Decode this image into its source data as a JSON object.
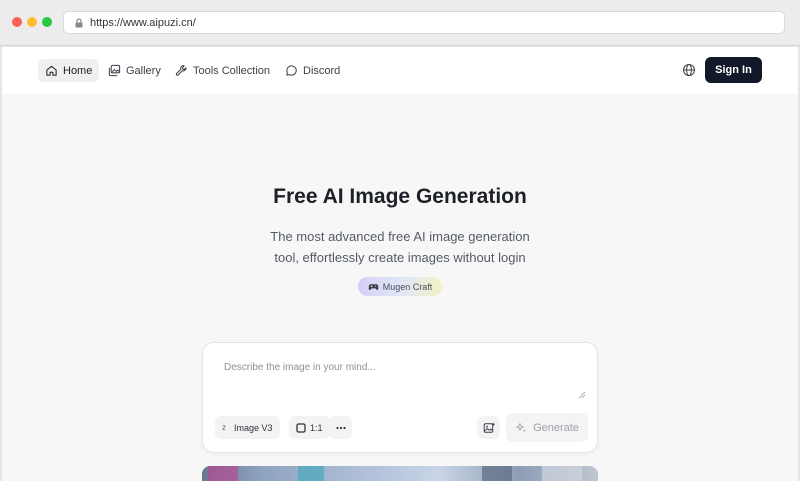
{
  "browser": {
    "url": "https://www.aipuzi.cn/"
  },
  "nav": {
    "items": [
      {
        "label": "Home",
        "icon": "home-icon",
        "active": true
      },
      {
        "label": "Gallery",
        "icon": "gallery-icon",
        "active": false
      },
      {
        "label": "Tools Collection",
        "icon": "wrench-icon",
        "active": false
      },
      {
        "label": "Discord",
        "icon": "chat-bubble-icon",
        "active": false
      }
    ],
    "language_icon": "globe-icon",
    "sign_in_label": "Sign In"
  },
  "hero": {
    "title": "Free AI Image Generation",
    "subtitle_line1": "The most advanced free AI image generation",
    "subtitle_line2": "tool, effortlessly create images without login",
    "badge_label": "Mugen Craft",
    "badge_icon": "gamepad-icon"
  },
  "generator": {
    "prompt_placeholder": "Describe the image in your mind...",
    "model_prefix": "z",
    "model_label": "Image V3",
    "ratio_label": "1:1",
    "more_icon": "ellipsis-icon",
    "upload_icon": "image-upload-icon",
    "generate_label": "Generate",
    "generate_icon": "sparkles-icon"
  },
  "colors": {
    "signin_bg": "#111827",
    "page_bg": "#f7f7f8",
    "badge_gradient": [
      "#d8cdf6",
      "#dfe7f7",
      "#f3f1c7"
    ]
  }
}
